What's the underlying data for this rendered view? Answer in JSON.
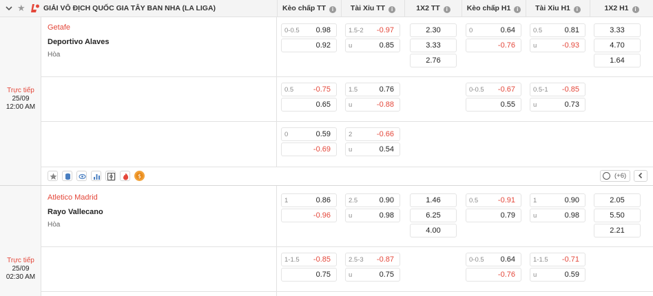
{
  "header": {
    "league": "GIẢI VÔ ĐỊCH QUỐC GIA TÂY BAN NHA (LA LIGA)",
    "columns": [
      "Kèo chấp TT",
      "Tài Xỉu TT",
      "1X2 TT",
      "Kèo chấp H1",
      "Tài Xỉu H1",
      "1X2 H1"
    ],
    "info_glyph": "i"
  },
  "icons_bar": {
    "more_label": "(+6)"
  },
  "matches": [
    {
      "status": "Trực tiếp",
      "date": "25/09",
      "time": "12:00 AM",
      "home": "Getafe",
      "away": "Deportivo Alaves",
      "draw": "Hòa",
      "rows": [
        {
          "hdp": {
            "line": "0-0.5",
            "home": "0.98",
            "away": "0.92",
            "home_neg": false,
            "away_neg": false
          },
          "ou": {
            "line": "1.5-2",
            "over": "-0.97",
            "under_label": "u",
            "under": "0.85",
            "over_neg": true,
            "under_neg": false
          },
          "x12": [
            "2.30",
            "3.33",
            "2.76"
          ],
          "hdp_h1": {
            "line": "0",
            "home": "0.64",
            "away": "-0.76",
            "home_neg": false,
            "away_neg": true
          },
          "ou_h1": {
            "line": "0.5",
            "over": "0.81",
            "under_label": "u",
            "under": "-0.93",
            "over_neg": false,
            "under_neg": true
          },
          "x12_h1": [
            "3.33",
            "4.70",
            "1.64"
          ]
        },
        {
          "hdp": {
            "line": "0.5",
            "home": "-0.75",
            "away": "0.65",
            "home_neg": true,
            "away_neg": false
          },
          "ou": {
            "line": "1.5",
            "over": "0.76",
            "under_label": "u",
            "under": "-0.88",
            "over_neg": false,
            "under_neg": true
          },
          "x12": [],
          "hdp_h1": {
            "line": "0-0.5",
            "home": "-0.67",
            "away": "0.55",
            "home_neg": true,
            "away_neg": false
          },
          "ou_h1": {
            "line": "0.5-1",
            "over": "-0.85",
            "under_label": "u",
            "under": "0.73",
            "over_neg": true,
            "under_neg": false
          },
          "x12_h1": []
        },
        {
          "hdp": {
            "line": "0",
            "home": "0.59",
            "away": "-0.69",
            "home_neg": false,
            "away_neg": true
          },
          "ou": {
            "line": "2",
            "over": "-0.66",
            "under_label": "u",
            "under": "0.54",
            "over_neg": true,
            "under_neg": false
          },
          "x12": [],
          "hdp_h1": null,
          "ou_h1": null,
          "x12_h1": []
        }
      ]
    },
    {
      "status": "Trực tiếp",
      "date": "25/09",
      "time": "02:30 AM",
      "home": "Atletico Madrid",
      "away": "Rayo Vallecano",
      "draw": "Hòa",
      "rows": [
        {
          "hdp": {
            "line": "1",
            "home": "0.86",
            "away": "-0.96",
            "home_neg": false,
            "away_neg": true
          },
          "ou": {
            "line": "2.5",
            "over": "0.90",
            "under_label": "u",
            "under": "0.98",
            "over_neg": false,
            "under_neg": false
          },
          "x12": [
            "1.46",
            "6.25",
            "4.00"
          ],
          "hdp_h1": {
            "line": "0.5",
            "home": "-0.91",
            "away": "0.79",
            "home_neg": true,
            "away_neg": false
          },
          "ou_h1": {
            "line": "1",
            "over": "0.90",
            "under_label": "u",
            "under": "0.98",
            "over_neg": false,
            "under_neg": false
          },
          "x12_h1": [
            "2.05",
            "5.50",
            "2.21"
          ]
        },
        {
          "hdp": {
            "line": "1-1.5",
            "home": "-0.85",
            "away": "0.75",
            "home_neg": true,
            "away_neg": false
          },
          "ou": {
            "line": "2.5-3",
            "over": "-0.87",
            "under_label": "u",
            "under": "0.75",
            "over_neg": true,
            "under_neg": false
          },
          "x12": [],
          "hdp_h1": {
            "line": "0-0.5",
            "home": "0.64",
            "away": "-0.76",
            "home_neg": false,
            "away_neg": true
          },
          "ou_h1": {
            "line": "1-1.5",
            "over": "-0.71",
            "under_label": "u",
            "under": "0.59",
            "over_neg": true,
            "under_neg": false
          },
          "x12_h1": []
        }
      ]
    }
  ],
  "colors": {
    "accent": "#e4473a",
    "header_bg": "#f4f4f4",
    "border": "#e2e2e2"
  }
}
